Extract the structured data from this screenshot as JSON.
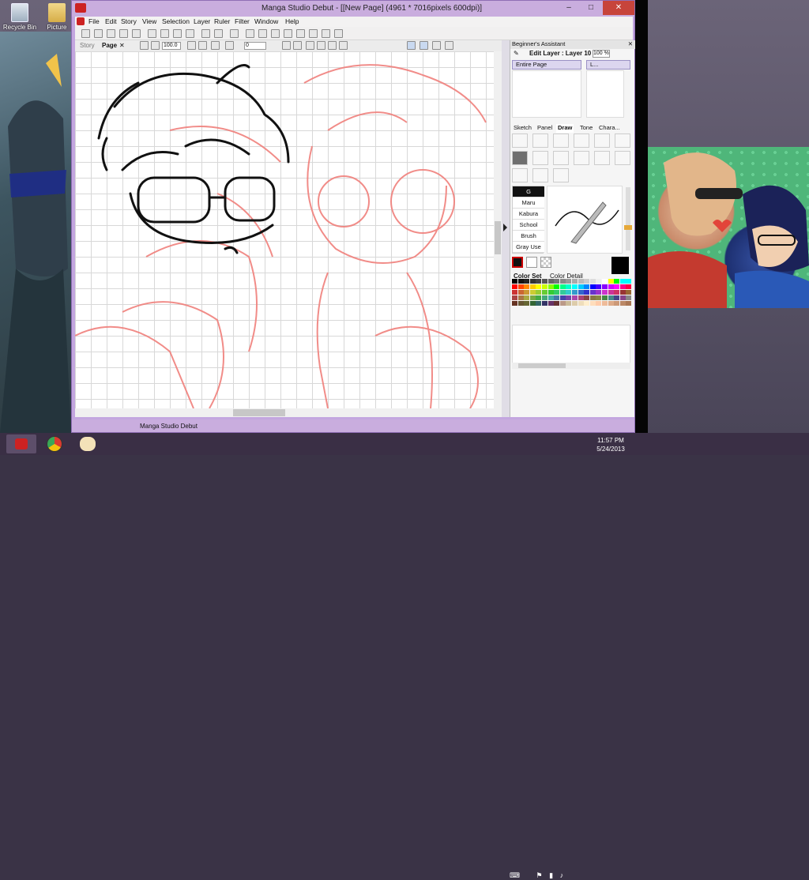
{
  "desktop": {
    "icons": [
      {
        "label": "Recycle Bin",
        "icon": "recycle-bin-icon"
      },
      {
        "label": "Picture",
        "icon": "folder-icon"
      }
    ]
  },
  "window": {
    "title": "Manga Studio Debut - [[New Page] (4961 * 7016pixels 600dpi)]",
    "controls": {
      "minimize": "–",
      "maximize": "□",
      "close": "✕"
    },
    "menu": [
      "File",
      "Edit",
      "Story",
      "View",
      "Selection",
      "Layer",
      "Ruler",
      "Filter",
      "Window",
      "Help"
    ],
    "tabs": {
      "story": "Story",
      "page": "Page",
      "close": "✕"
    },
    "zoom": "100.0",
    "rotation": "0",
    "status": "Manga Studio Debut"
  },
  "panel": {
    "assistant_title": "Beginner's Assistant",
    "assistant_close": "✕",
    "edit_layer": "Edit Layer : Layer 10",
    "opacity": "100 %",
    "scope": "Entire Page",
    "layer_short": "L...",
    "tool_tabs": [
      "Sketch",
      "Panel",
      "Draw",
      "Tone",
      "Chara..."
    ],
    "brushes": [
      "G",
      "Maru",
      "Kabura",
      "School",
      "Brush",
      "Gray Use"
    ],
    "color_tabs": [
      "Color Set",
      "Color Detail"
    ]
  },
  "taskbar": {
    "time": "11:57 PM",
    "date": "5/24/2013",
    "apps": [
      "manga-studio-icon",
      "chrome-icon",
      "paint-icon"
    ]
  },
  "colors": {
    "window_frame": "#c3a6df",
    "sketch_red": "#f0807c",
    "line_black": "#111111"
  }
}
